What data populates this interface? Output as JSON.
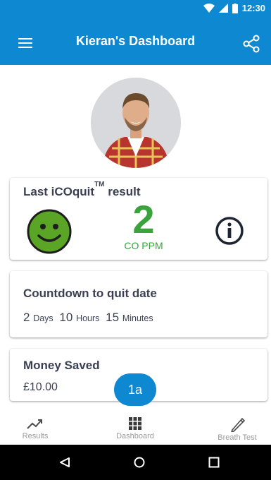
{
  "status": {
    "time": "12:30"
  },
  "header": {
    "title": "Kieran's Dashboard"
  },
  "result_card": {
    "title": "Last iCOquit",
    "trademark": "TM",
    "title_suffix": " result",
    "value": "2",
    "unit": "CO PPM"
  },
  "countdown_card": {
    "title": "Countdown to quit date",
    "days_value": "2",
    "days_label": "Days",
    "hours_value": "10",
    "hours_label": "Hours",
    "minutes_value": "15",
    "minutes_label": "Minutes"
  },
  "money_card": {
    "title": "Money Saved",
    "value": "£10.00"
  },
  "badge": {
    "label": "1a"
  },
  "bottom_nav": {
    "results": "Results",
    "dashboard": "Dashboard",
    "breath_test": "Breath Test"
  },
  "icons": [
    "menu-icon",
    "share-icon",
    "smiley-icon",
    "info-icon",
    "trending-icon",
    "grid-icon",
    "pen-icon",
    "back-icon",
    "home-icon",
    "recents-icon"
  ],
  "colors": {
    "primary": "#0e88d1",
    "green": "#3aa33b",
    "smiley_fill": "#5aa526",
    "text_dark": "#3b3f52"
  }
}
